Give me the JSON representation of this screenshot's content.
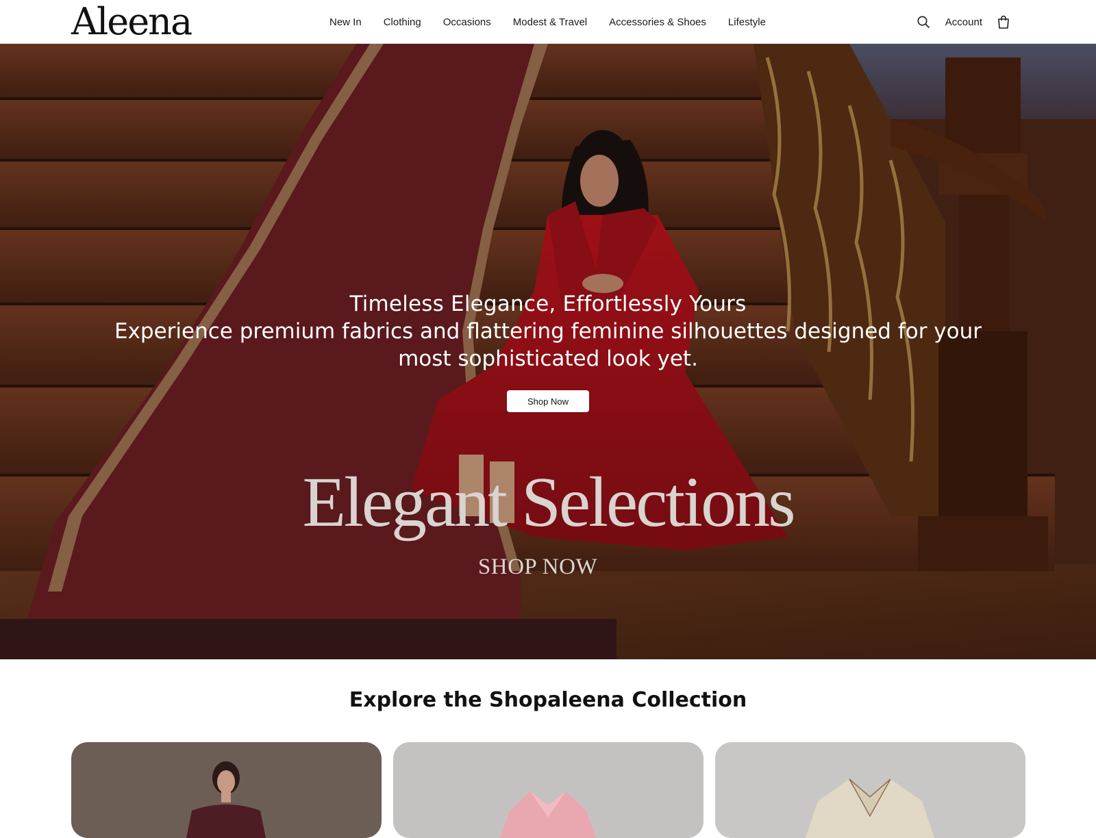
{
  "brand": {
    "logo_text": "Aleena"
  },
  "nav": {
    "items": [
      {
        "label": "New In"
      },
      {
        "label": "Clothing"
      },
      {
        "label": "Occasions"
      },
      {
        "label": "Modest & Travel"
      },
      {
        "label": "Accessories & Shoes"
      },
      {
        "label": "Lifestyle"
      }
    ]
  },
  "header": {
    "search_icon": "search-icon",
    "account_label": "Account",
    "cart_icon": "shopping-bag-icon"
  },
  "hero": {
    "title": "Timeless Elegance, Effortlessly Yours",
    "subtitle": "Experience premium fabrics and flattering feminine silhouettes designed for your most sophisticated look yet.",
    "button_label": "Shop Now",
    "image_headline": "Elegant Selections",
    "image_cta": "SHOP NOW"
  },
  "collection": {
    "title": "Explore the Shopaleena Collection",
    "cards": [
      {
        "image": "woman-in-burgundy-dress"
      },
      {
        "image": "pink-blouse"
      },
      {
        "image": "cream-embroidered-blouse"
      }
    ]
  },
  "colors": {
    "text": "#1a1a1a",
    "hero_dress": "#b3141c",
    "carpet": "#6e1f24",
    "wood": "#5a2d1a"
  }
}
